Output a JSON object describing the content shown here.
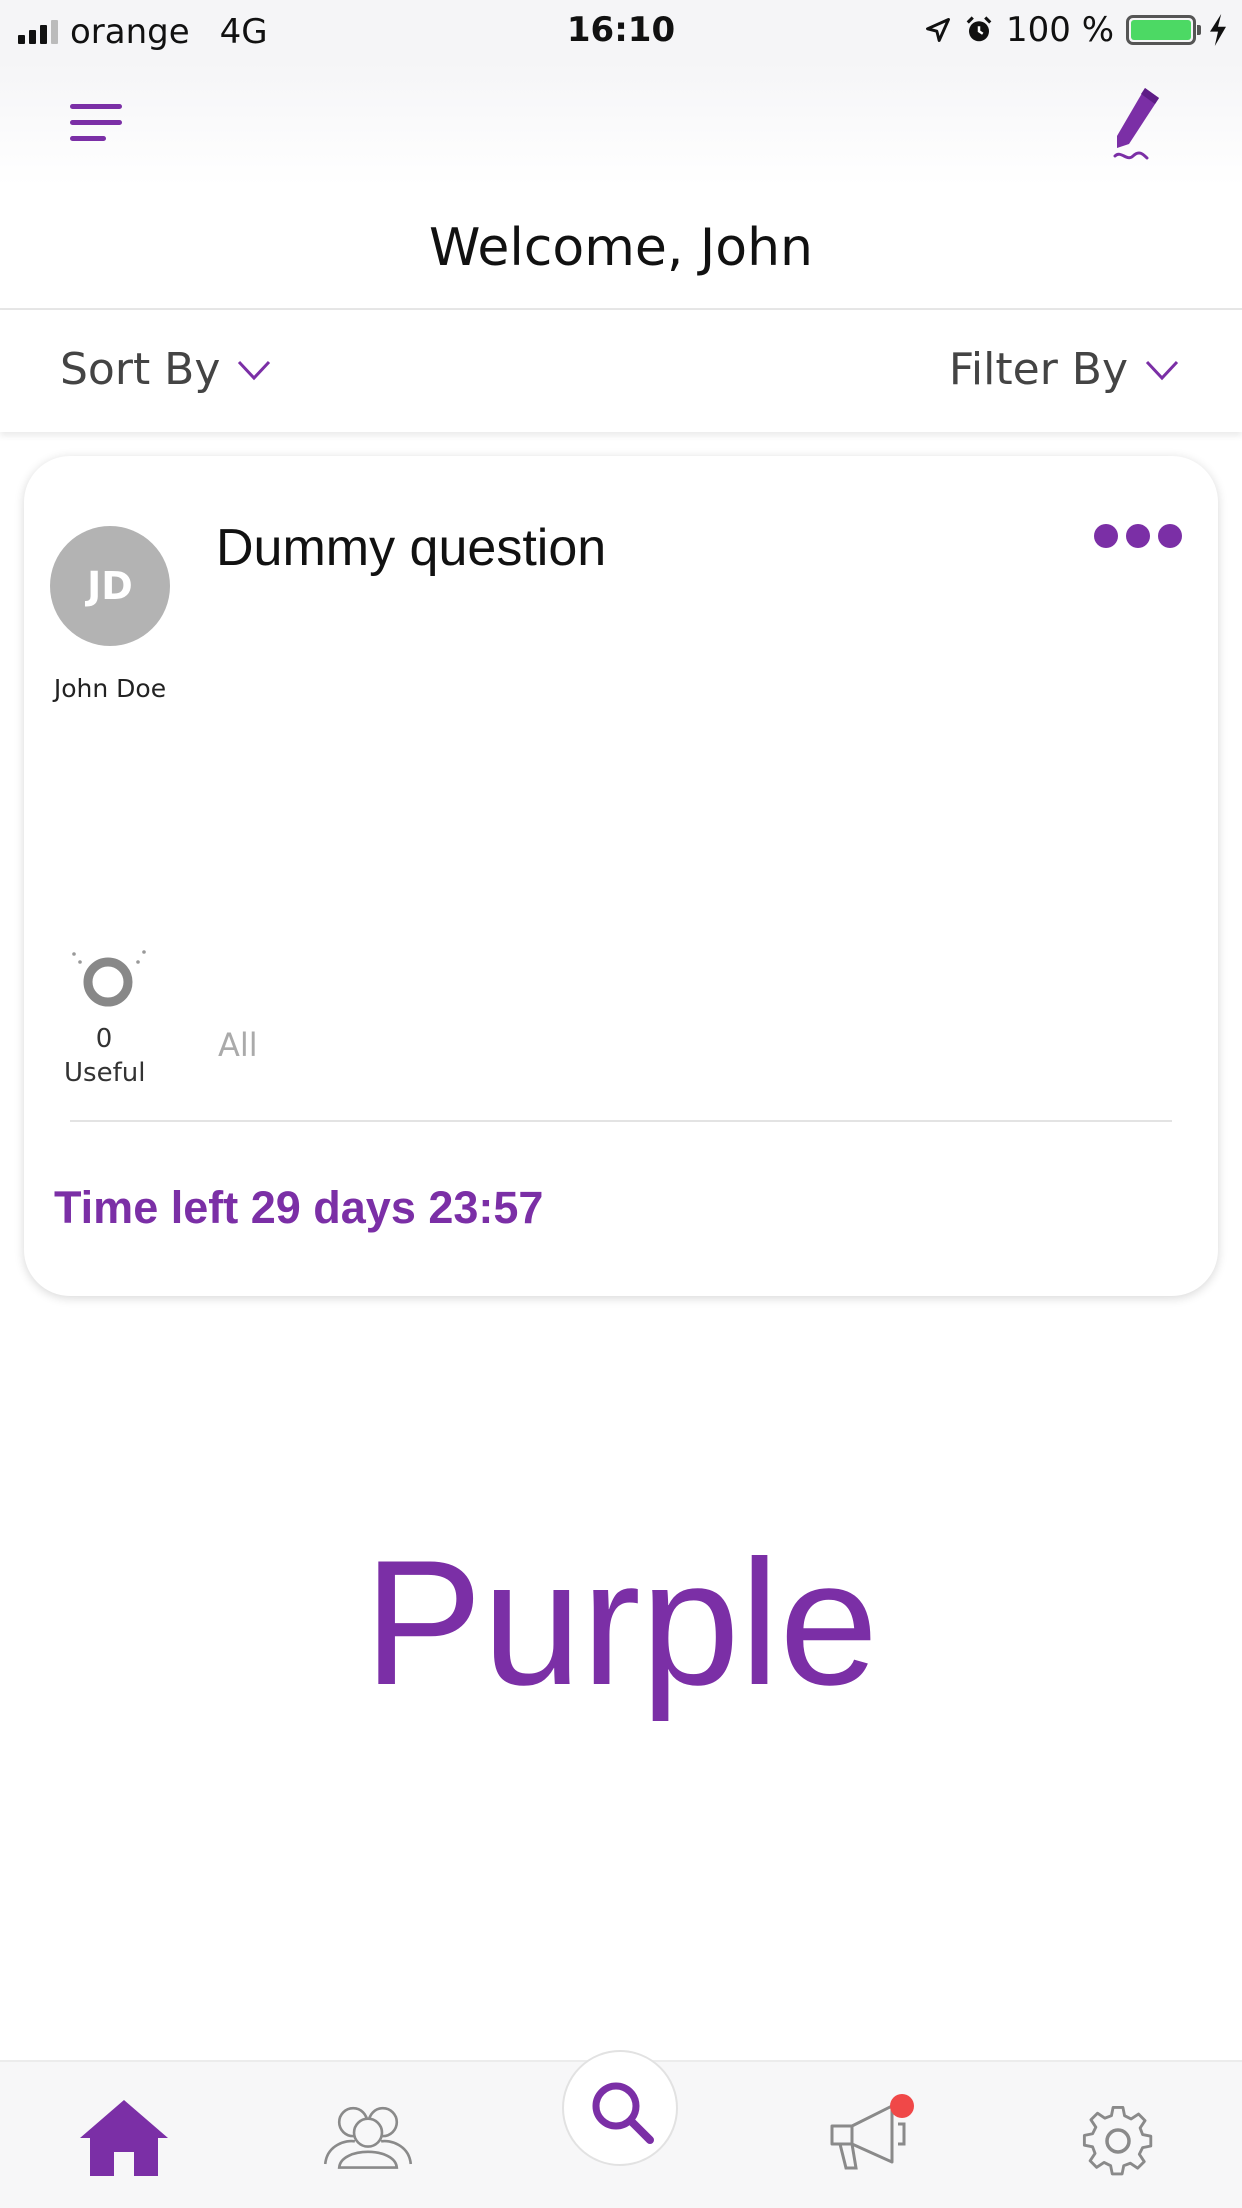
{
  "status_bar": {
    "carrier": "orange",
    "network": "4G",
    "time": "16:10",
    "battery_percent": "100 %",
    "battery_level": 1.0
  },
  "header": {
    "menu_icon": "hamburger-menu-icon",
    "compose_icon": "pencil-icon",
    "welcome": "Welcome, John"
  },
  "sort_bar": {
    "sort_label": "Sort By",
    "filter_label": "Filter By"
  },
  "card": {
    "avatar_initials": "JD",
    "author": "John Doe",
    "title": "Dummy question",
    "useful_count": "0",
    "useful_label": "Useful",
    "all_label": "All",
    "time_left": "Time left 29 days 23:57"
  },
  "watermark": "Purple",
  "tab_bar": {
    "items": [
      "home-icon",
      "people-icon",
      "search-icon",
      "megaphone-icon",
      "gear-icon"
    ],
    "active": "home-icon"
  },
  "colors": {
    "accent": "#7b2fa6",
    "notification": "#f04848",
    "battery": "#4cd964"
  }
}
